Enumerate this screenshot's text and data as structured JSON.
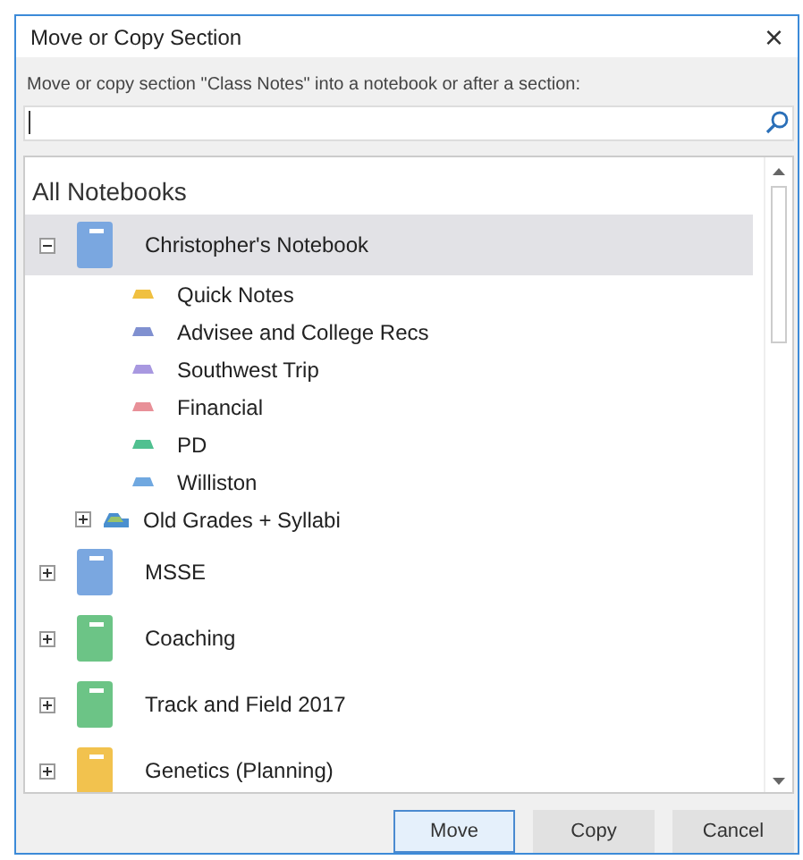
{
  "window": {
    "title": "Move or Copy Section",
    "close": "×"
  },
  "instruction": "Move or copy section \"Class Notes\" into a notebook or after a section:",
  "tree": {
    "heading": "All Notebooks",
    "notebooks": [
      {
        "name": "Christopher's Notebook",
        "color": "#7aa7e0",
        "expanded": true,
        "selected": true,
        "children": [
          {
            "kind": "section",
            "name": "Quick Notes",
            "color": "#f0c040"
          },
          {
            "kind": "section",
            "name": "Advisee and College Recs",
            "color": "#8090d0"
          },
          {
            "kind": "section",
            "name": "Southwest Trip",
            "color": "#a898e0"
          },
          {
            "kind": "section",
            "name": "Financial",
            "color": "#e89098"
          },
          {
            "kind": "section",
            "name": "PD",
            "color": "#50c090"
          },
          {
            "kind": "section",
            "name": "Williston",
            "color": "#70a8e0"
          },
          {
            "kind": "group",
            "name": "Old Grades + Syllabi",
            "expanded": false
          }
        ]
      },
      {
        "name": "MSSE",
        "color": "#7aa7e0",
        "expanded": false,
        "selected": false
      },
      {
        "name": "Coaching",
        "color": "#6cc486",
        "expanded": false,
        "selected": false
      },
      {
        "name": "Track and Field 2017",
        "color": "#6cc486",
        "expanded": false,
        "selected": false
      },
      {
        "name": "Genetics (Planning)",
        "color": "#f2c24e",
        "expanded": false,
        "selected": false
      }
    ]
  },
  "buttons": [
    {
      "label": "Move",
      "default": true
    },
    {
      "label": "Copy",
      "default": false
    },
    {
      "label": "Cancel",
      "default": false
    }
  ]
}
